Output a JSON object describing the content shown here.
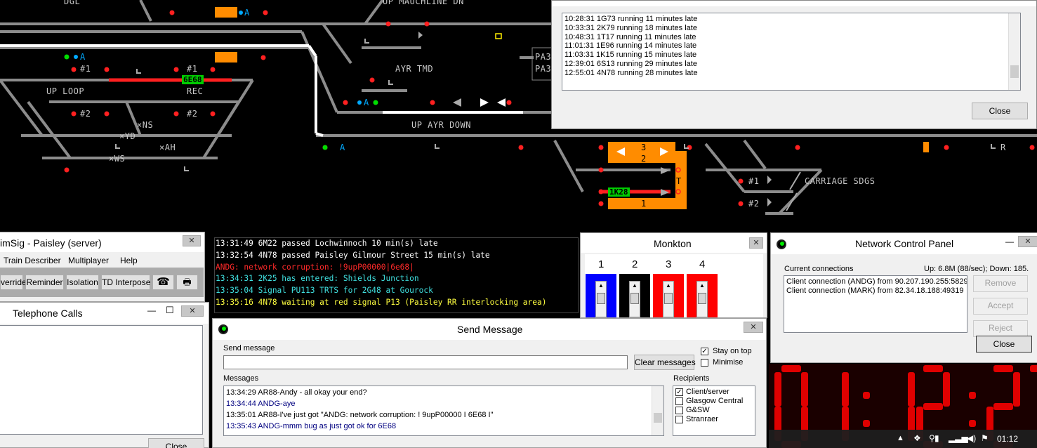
{
  "diagram": {
    "labels": {
      "dgl": "DGL",
      "up_mauchline_dn": "UP MAUCHLINE DN",
      "hash1_a": "#1",
      "hash1_b": "#1",
      "up_loop": "UP LOOP",
      "rec": "REC",
      "hash2_a": "#2",
      "hash2_b": "#2",
      "ns": "×NS",
      "yd": "×YD",
      "ah": "×AH",
      "ws": "×WS",
      "ayr_tmd": "AYR TMD",
      "up_ayr_down": "UP AYR DOWN",
      "pa3_a": "PA3",
      "pa3_b": "PA3",
      "carriage_sdgs": "CARRIAGE SDGS",
      "hash1_c": "#1",
      "hash2_c": "#2",
      "plat3": "3",
      "plat2": "2",
      "plat1": "1",
      "t": "T",
      "r": "R",
      "a1": "A",
      "a2": "A",
      "a3": "A",
      "a4": "A"
    },
    "berths": {
      "b6e68": "6E68",
      "b1k28": "1K28"
    }
  },
  "late_window": {
    "lines": [
      "10:28:31 1G73 running 11 minutes late",
      "10:33:31 2K79 running 18 minutes late",
      "10:48:31 1T17 running 11 minutes late",
      "11:01:31 1E96 running 14 minutes late",
      "11:03:31 1K15 running 15 minutes late",
      "12:39:01 6S13 running 29 minutes late",
      "12:55:01 4N78 running 28 minutes late"
    ],
    "close_label": "Close"
  },
  "simsig": {
    "title": "imSig - Paisley (server)",
    "menu": [
      "Train Describer",
      "Multiplayer",
      "Help"
    ],
    "toolbar": {
      "override": "verride",
      "reminder": "Reminder",
      "isolation": "Isolation",
      "td_interpose": "TD Interpose"
    }
  },
  "telephone": {
    "title": "Telephone Calls",
    "close_label": "Close"
  },
  "log": {
    "lines": [
      {
        "text": "13:31:49 6M22 passed Lochwinnoch 10 min(s) late",
        "color": "#ffffff"
      },
      {
        "text": "13:32:54 4N78 passed Paisley Gilmour Street 15 min(s) late",
        "color": "#ffffff"
      },
      {
        "text": "ANDG: network corruption: !9upP00000|6e68|",
        "color": "#ff2a2a"
      },
      {
        "text": "13:34:31 2K25 has entered: Shields Junction",
        "color": "#40e0e0"
      },
      {
        "text": "13:35:04 Signal PU113 TRTS for 2G48 at Gourock",
        "color": "#40e0e0"
      },
      {
        "text": "13:35:16 4N78 waiting at red signal P13 (Paisley RR interlocking area)",
        "color": "#ffff40"
      }
    ]
  },
  "monkton": {
    "title": "Monkton",
    "levers": [
      {
        "num": "1",
        "color": "#0000ff"
      },
      {
        "num": "2",
        "color": "#000000"
      },
      {
        "num": "3",
        "color": "#ff0000"
      },
      {
        "num": "4",
        "color": "#ff0000"
      }
    ]
  },
  "network": {
    "title": "Network Control Panel",
    "current_label": "Current connections",
    "stats": "Up: 6.8M (88/sec);   Down: 185.",
    "connections": [
      "Client connection (ANDG) from 90.207.190.255:58294",
      "Client connection (MARK) from 82.34.18.188:49319"
    ],
    "remove_label": "Remove",
    "accept_label": "Accept",
    "reject_label": "Reject",
    "close_label": "Close"
  },
  "send": {
    "title": "Send Message",
    "send_label": "Send message",
    "input_value": "",
    "clear_label": "Clear messages",
    "stay_on_top": "Stay on top",
    "minimise": "Minimise",
    "messages_label": "Messages",
    "recipients_label": "Recipients",
    "messages": [
      {
        "text": "13:34:29 AR88-Andy - all okay your end?",
        "color": "#000000"
      },
      {
        "text": "13:34:44 ANDG-aye",
        "color": "#000080"
      },
      {
        "text": "13:35:01 AR88-I've just got \"ANDG: network corruption: ! 9upP00000 I 6E68 I\"",
        "color": "#000000"
      },
      {
        "text": "13:35:43 ANDG-mmm bug as just got ok for 6E68",
        "color": "#000080"
      }
    ],
    "recipients": [
      {
        "name": "Client/server",
        "checked": true
      },
      {
        "name": "Glasgow Central",
        "checked": false
      },
      {
        "name": "G&SW",
        "checked": false
      },
      {
        "name": "Stranraer",
        "checked": false
      }
    ]
  },
  "taskbar": {
    "time": "01:12"
  }
}
